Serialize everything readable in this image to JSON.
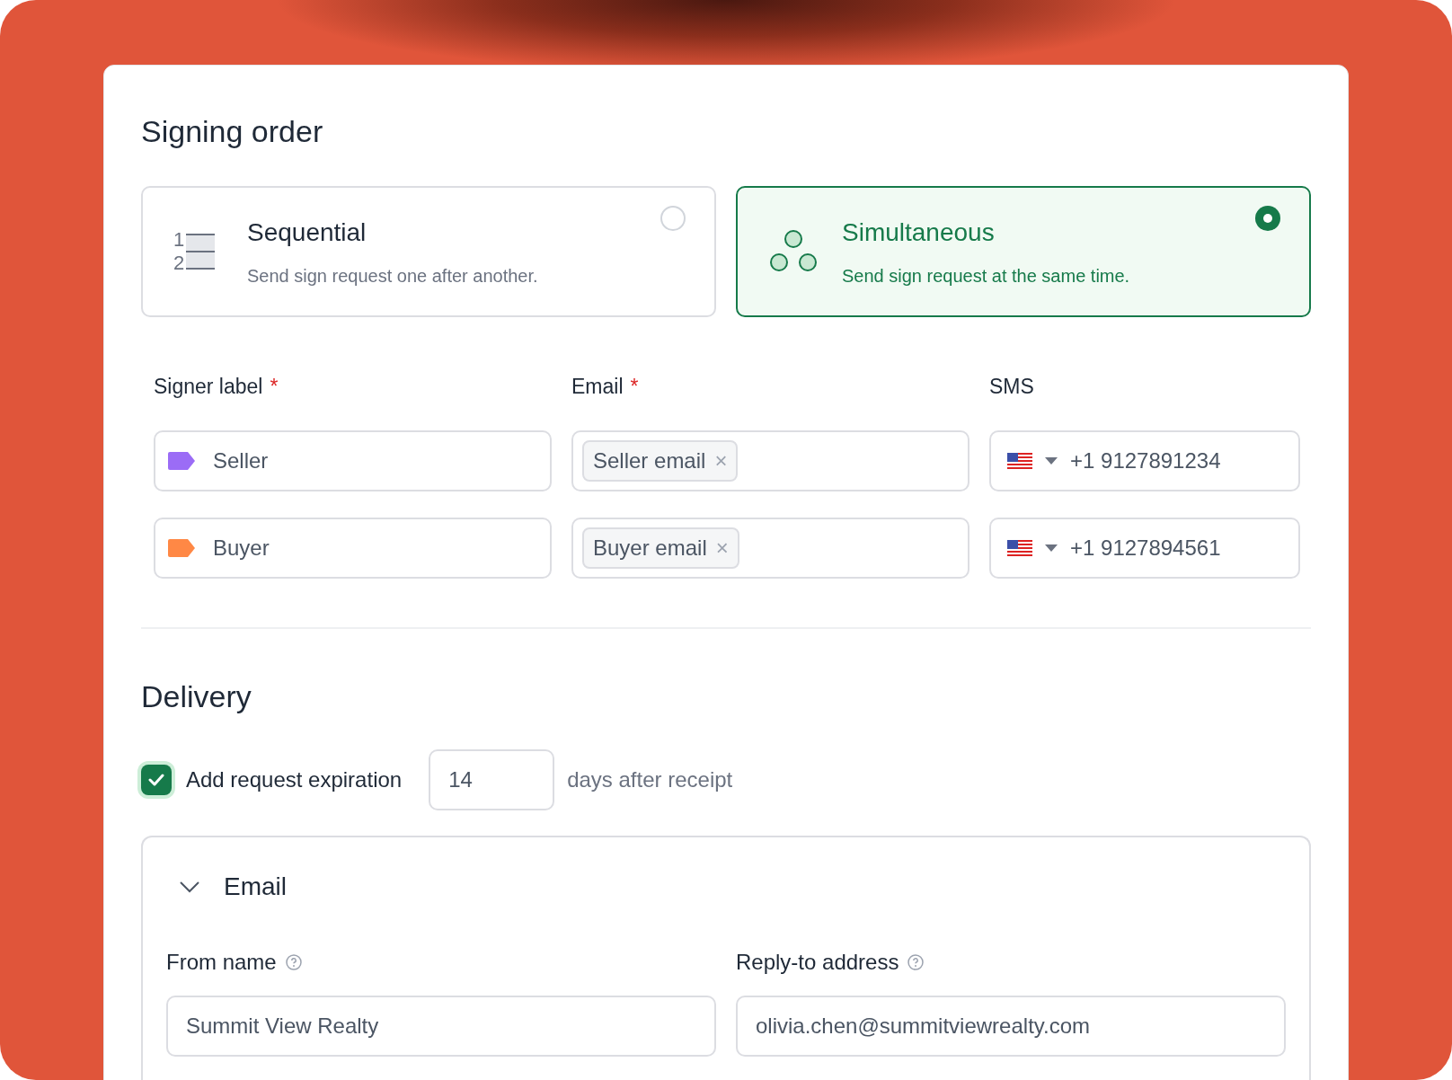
{
  "signing_order": {
    "title": "Signing order",
    "options": [
      {
        "kind": "sequential",
        "title": "Sequential",
        "description": "Send sign request one after another.",
        "selected": false,
        "num_1": "1",
        "num_2": "2"
      },
      {
        "kind": "simultaneous",
        "title": "Simultaneous",
        "description": "Send sign request at the same time.",
        "selected": true
      }
    ],
    "columns": [
      {
        "label": "Signer label",
        "mark": "*"
      },
      {
        "label": "Email",
        "mark": "*"
      },
      {
        "label": "SMS"
      }
    ],
    "signers": [
      {
        "label": "Seller",
        "color": "#9b6cf6",
        "email_chip": "Seller email",
        "remove": "×",
        "phone": "+1 9127891234"
      },
      {
        "label": "Buyer",
        "color": "#ff8845",
        "email_chip": "Buyer email",
        "remove": "×",
        "phone": "+1 9127894561"
      }
    ]
  },
  "delivery": {
    "title": "Delivery",
    "expiration": {
      "label": "Add request expiration",
      "checked": true,
      "value": "14",
      "suffix": "days after receipt"
    },
    "email": {
      "title": "Email",
      "expanded": true,
      "from_name": {
        "label": "From name",
        "value": "Summit View Realty"
      },
      "reply_to": {
        "label": "Reply-to address",
        "value": "olivia.chen@summitviewrealty.com"
      }
    }
  }
}
